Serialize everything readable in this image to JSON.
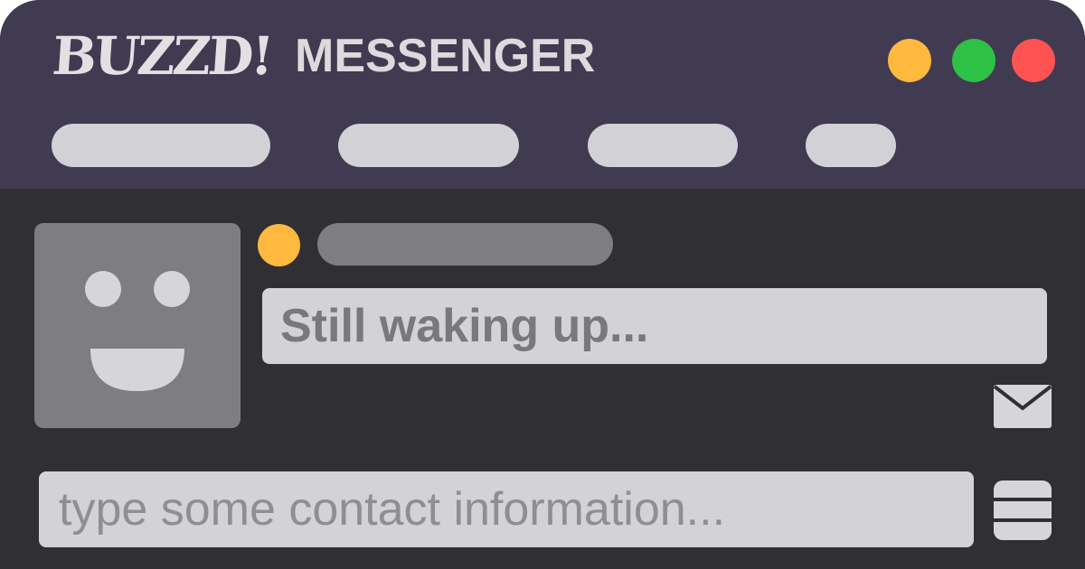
{
  "app": {
    "brand": "BUZZD!",
    "title": "MESSENGER"
  },
  "window_controls": [
    {
      "name": "minimize",
      "color": "#ffb93e"
    },
    {
      "name": "maximize",
      "color": "#2dc245"
    },
    {
      "name": "close",
      "color": "#ff5252"
    }
  ],
  "menu": {
    "items": [
      "",
      "",
      "",
      ""
    ],
    "color": "#d2d1d5"
  },
  "contact": {
    "avatar_icon": "smiley-face-icon",
    "status_color": "#ffb93e",
    "status_message": "Still waking up..."
  },
  "icons": {
    "message": "envelope-icon",
    "menu": "hamburger-menu-icon"
  },
  "compose": {
    "placeholder": "type some contact information..."
  },
  "colors": {
    "titlebar": "#403b51",
    "body": "#303034",
    "text_light": "#e2e0e3",
    "panel": "#d3d2d6",
    "avatar": "#7e7e80"
  }
}
